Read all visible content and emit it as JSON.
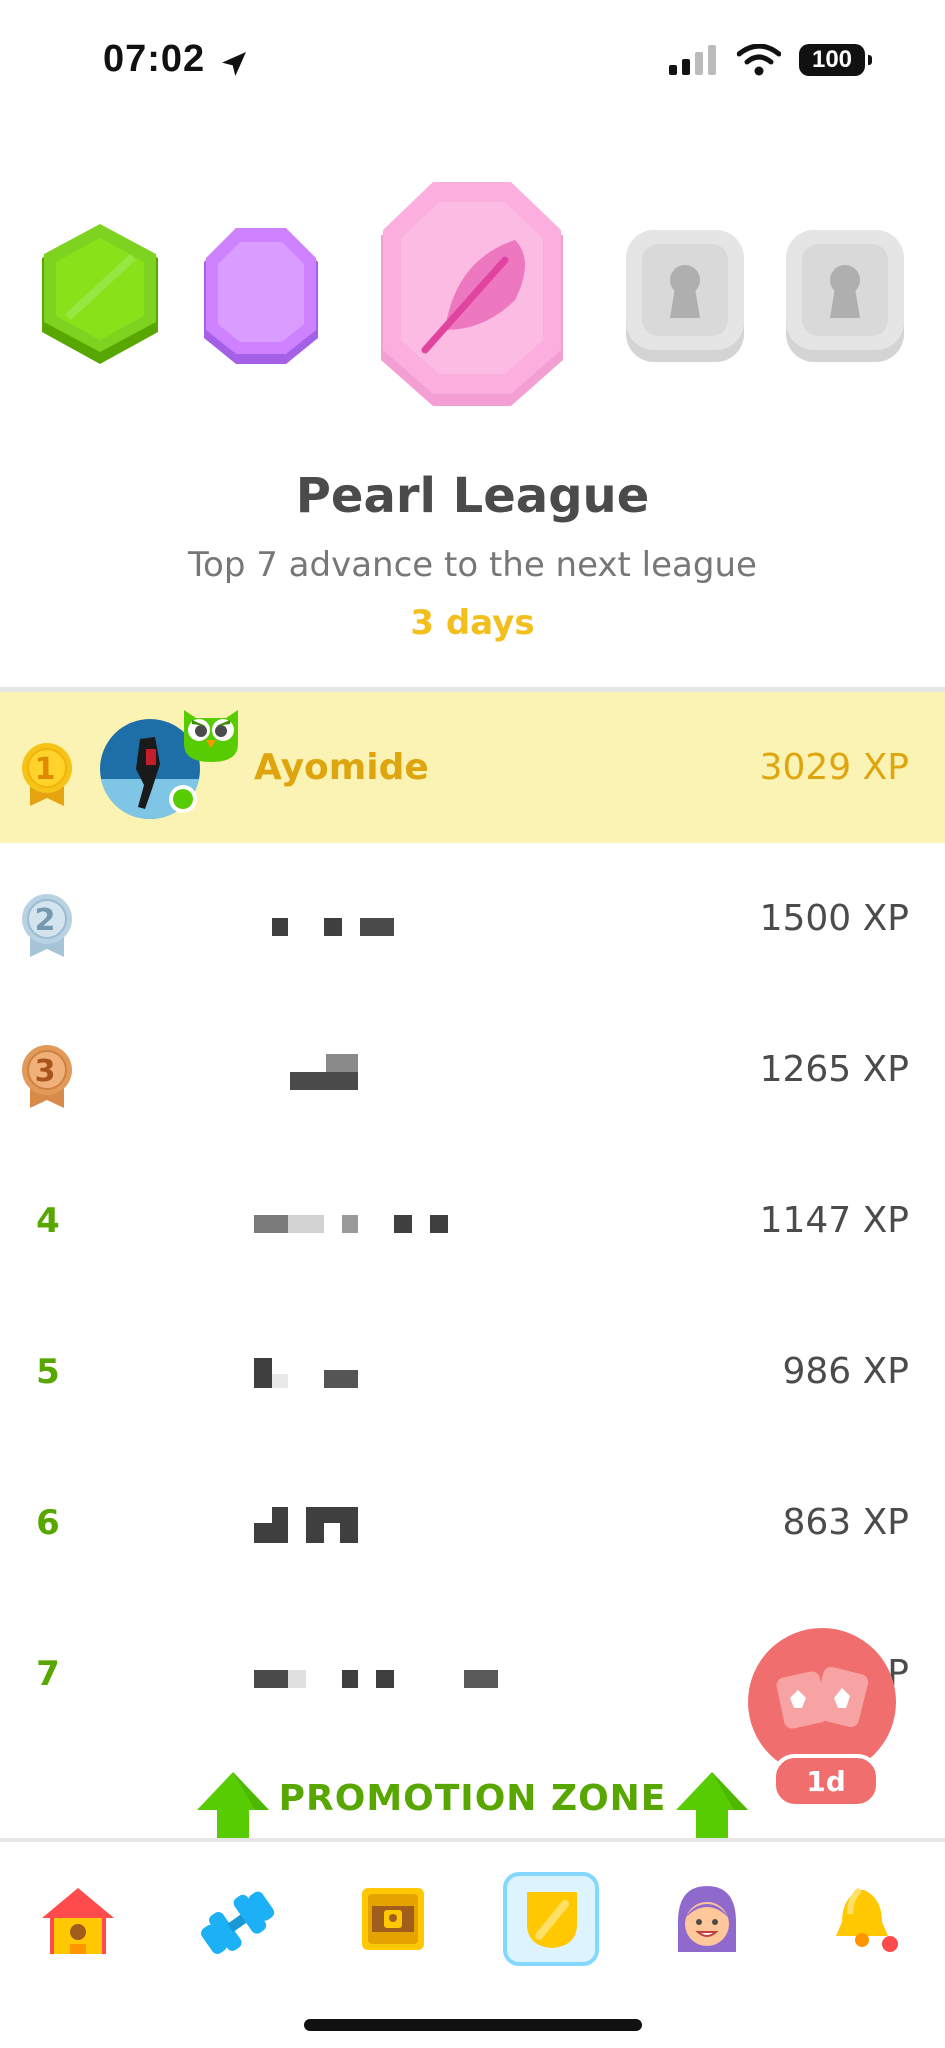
{
  "status_bar": {
    "time": "07:02",
    "battery": "100"
  },
  "league": {
    "title": "Pearl League",
    "subtitle": "Top 7 advance to the next league",
    "time_left": "3 days",
    "badges": [
      {
        "name": "emerald",
        "color": "#7ed321",
        "state": "unlocked"
      },
      {
        "name": "amethyst",
        "color": "#ce82ff",
        "state": "unlocked"
      },
      {
        "name": "pearl",
        "color": "#fcaede",
        "state": "current"
      },
      {
        "name": "locked-1",
        "color": "#e5e5e5",
        "state": "locked"
      },
      {
        "name": "locked-2",
        "color": "#e5e5e5",
        "state": "locked"
      }
    ]
  },
  "leaderboard": [
    {
      "rank": "1",
      "name": "Ayomide",
      "xp": "3029 XP",
      "current_user": true
    },
    {
      "rank": "2",
      "name": "",
      "xp": "1500 XP"
    },
    {
      "rank": "3",
      "name": "",
      "xp": "1265 XP"
    },
    {
      "rank": "4",
      "name": "",
      "xp": "1147 XP"
    },
    {
      "rank": "5",
      "name": "",
      "xp": "986 XP"
    },
    {
      "rank": "6",
      "name": "",
      "xp": "863 XP"
    },
    {
      "rank": "7",
      "name": "",
      "xp": "P"
    }
  ],
  "promotion_zone_label": "PROMOTION ZONE",
  "chest_timer": "1d",
  "tabs": [
    {
      "name": "home",
      "icon": "home-icon"
    },
    {
      "name": "practice",
      "icon": "dumbbell-icon"
    },
    {
      "name": "quests",
      "icon": "treasure-chest-icon"
    },
    {
      "name": "leaderboard",
      "icon": "league-shield-icon",
      "active": true
    },
    {
      "name": "profile",
      "icon": "avatar-icon"
    },
    {
      "name": "notifications",
      "icon": "bell-icon",
      "badge": true
    }
  ],
  "colors": {
    "accent": "#58a700",
    "gold": "#dea50f",
    "highlight": "#fbf3b4",
    "days": "#f2bf1c"
  }
}
